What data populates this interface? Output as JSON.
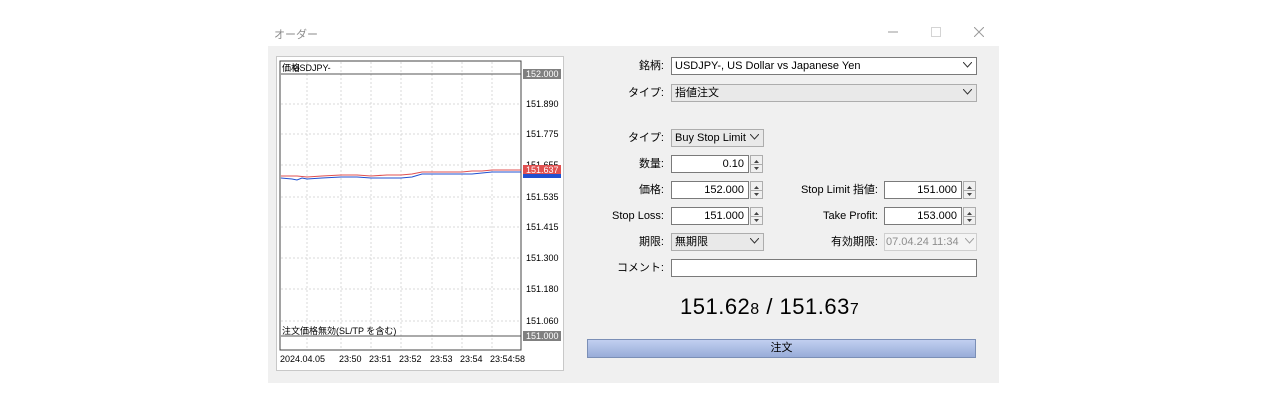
{
  "window": {
    "title": "オーダー"
  },
  "chart": {
    "symbol_label": "USDJPY-",
    "overlay_label": "価格",
    "bottom_note": "注文価格無効(SL/TP を含む)",
    "price_ticks": [
      "152.000",
      "151.890",
      "151.775",
      "151.655",
      "151.535",
      "151.415",
      "151.300",
      "151.180",
      "151.060",
      "151.000"
    ],
    "current_price_tag": "151.637",
    "top_price_tag": "152.000",
    "bottom_price_tag": "151.000",
    "time_labels": [
      "2024.04.05",
      "23:50",
      "23:51",
      "23:52",
      "23:53",
      "23:54",
      "23:54:58"
    ],
    "colors": {
      "ask": "#e05050",
      "bid": "#2050d0",
      "tag_red": "#e05050",
      "tag_grey": "#808080"
    }
  },
  "form": {
    "symbol_label": "銘柄:",
    "symbol_value": "USDJPY-, US Dollar vs Japanese Yen",
    "type_label": "タイプ:",
    "type_value": "指値注文",
    "order_type_label": "タイプ:",
    "order_type_value": "Buy Stop Limit",
    "volume_label": "数量:",
    "volume_value": "0.10",
    "price_label": "価格:",
    "price_value": "152.000",
    "stop_limit_label": "Stop Limit 指値:",
    "stop_limit_value": "151.000",
    "stop_loss_label": "Stop Loss:",
    "stop_loss_value": "151.000",
    "take_profit_label": "Take Profit:",
    "take_profit_value": "153.000",
    "expiry_label": "期限:",
    "expiry_value": "無期限",
    "valid_label": "有効期限:",
    "valid_value": "07.04.24 11:34",
    "comment_label": "コメント:",
    "comment_value": ""
  },
  "quote": {
    "bid_main": "151.62",
    "bid_small": "8",
    "sep": " / ",
    "ask_main": "151.63",
    "ask_small": "7"
  },
  "order_button": "注文"
}
